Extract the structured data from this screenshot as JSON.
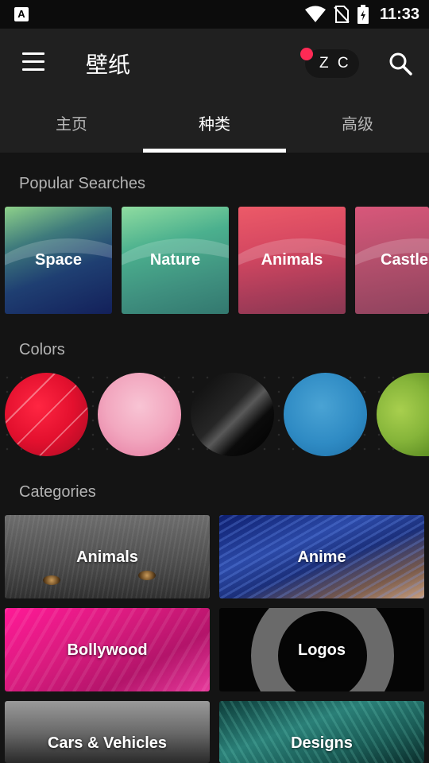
{
  "status_bar": {
    "time": "11:33",
    "icons": [
      "app-notification-icon",
      "wifi-icon",
      "no-sim-icon",
      "battery-charging-icon"
    ]
  },
  "app_bar": {
    "title": "壁纸",
    "chip_text": "Z C",
    "chip_dot_color": "#ff2a55",
    "icons": [
      "menu-icon",
      "search-icon"
    ]
  },
  "tabs": [
    {
      "label": "主页",
      "active": false
    },
    {
      "label": "种类",
      "active": true
    },
    {
      "label": "高级",
      "active": false
    }
  ],
  "popular": {
    "title": "Popular Searches",
    "items": [
      "Space",
      "Nature",
      "Animals",
      "Castle"
    ]
  },
  "colors": {
    "title": "Colors",
    "swatches": [
      "#e3102e",
      "#f2a7bf",
      "#111111",
      "#2f8bc4",
      "#86b53a"
    ]
  },
  "categories": {
    "title": "Categories",
    "items": [
      "Animals",
      "Anime",
      "Bollywood",
      "Logos",
      "Cars & Vehicles",
      "Designs"
    ]
  }
}
